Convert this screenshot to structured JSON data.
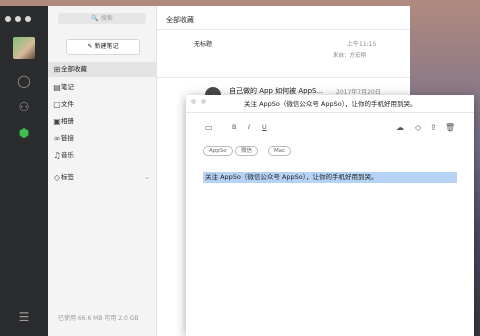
{
  "main": {
    "search_placeholder": "搜索",
    "new_note": "新建笔记",
    "list_title": "全部收藏",
    "nav": [
      {
        "label": "全部收藏",
        "icon": "collection-icon"
      },
      {
        "label": "笔记",
        "icon": "note-icon"
      },
      {
        "label": "文件",
        "icon": "file-icon"
      },
      {
        "label": "相册",
        "icon": "album-icon"
      },
      {
        "label": "链接",
        "icon": "link-icon"
      },
      {
        "label": "音乐",
        "icon": "music-icon"
      },
      {
        "label": "标签",
        "icon": "tag-icon"
      }
    ],
    "storage": "已使用 66.6 MB 可用 2.0 GB",
    "items": [
      {
        "title": "无标题",
        "time": "上午11:15",
        "source": "来自：方宏翔"
      },
      {
        "title": "自己做的 App 如何被 AppS...",
        "time": "2017年7月20日"
      }
    ]
  },
  "editor": {
    "title": "关注 AppSo（微信公众号 AppSo），让你的手机好用到哭。",
    "tags": [
      "AppSo",
      "微信",
      "Mac"
    ],
    "body": "关注 AppSo（微信公众号 AppSo），让你的手机好用到哭。",
    "format": {
      "bold": "B",
      "italic": "I",
      "underline": "U"
    }
  }
}
